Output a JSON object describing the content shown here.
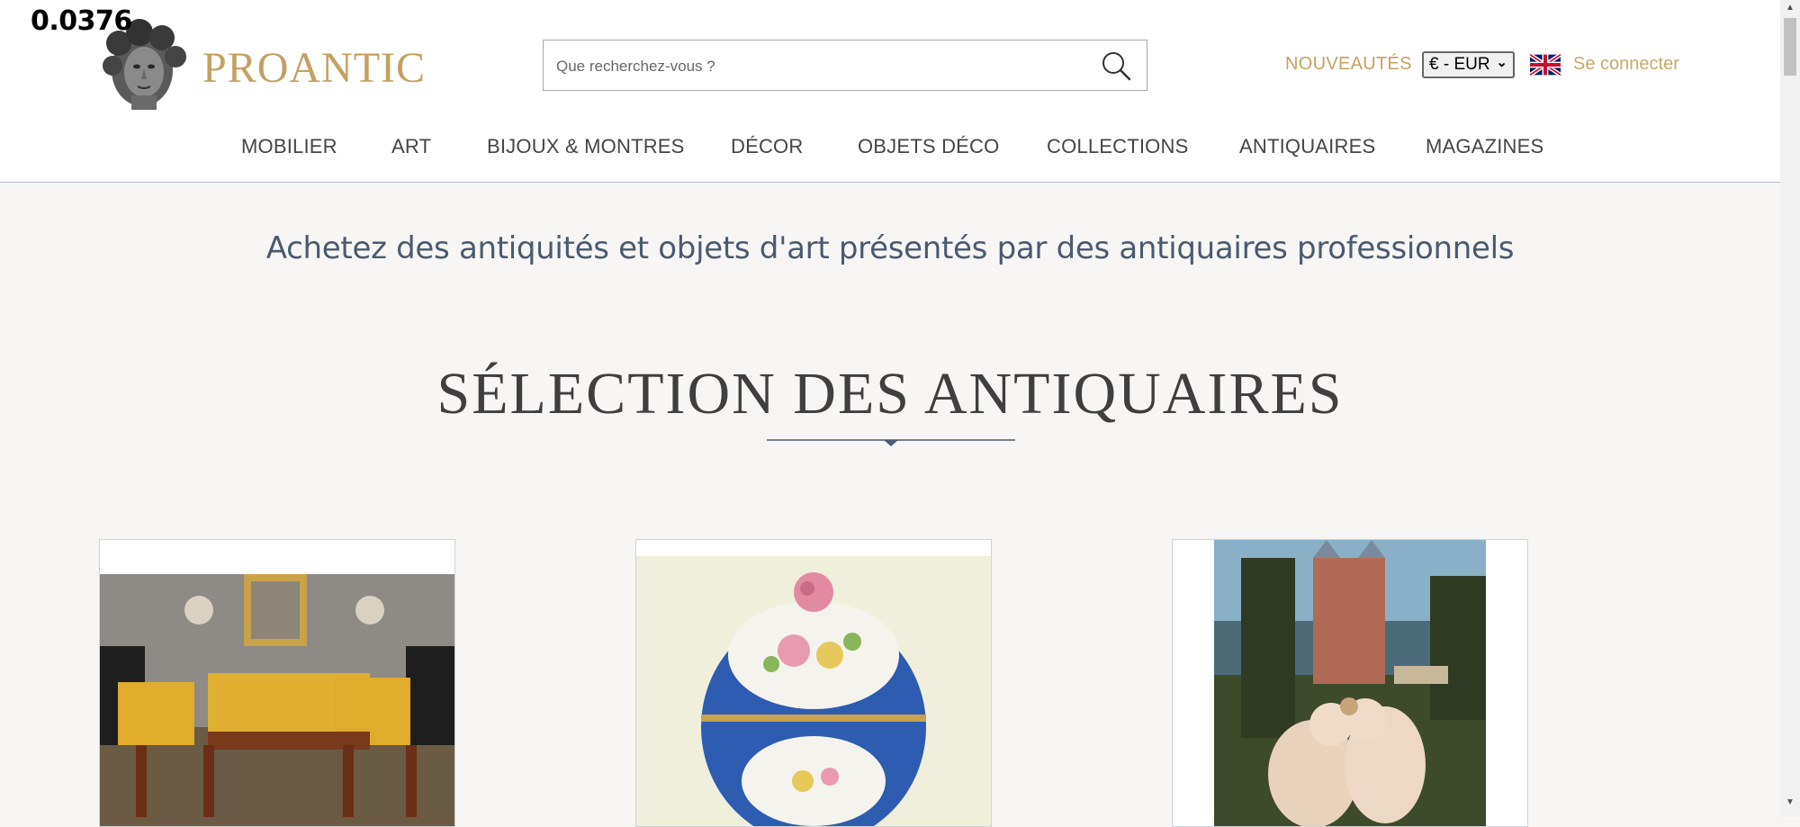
{
  "overlay": {
    "counter": "0.0376"
  },
  "brand": {
    "name": "PROANTIC",
    "gold": "#c4a062"
  },
  "search": {
    "placeholder": "Que recherchez-vous ?",
    "icon": "search-icon"
  },
  "header": {
    "nouveautes": "NOUVEAUTÉS",
    "currency": "€ - EUR",
    "language_flag": "uk-flag-icon",
    "login": "Se connecter"
  },
  "nav": {
    "items": [
      {
        "label": "MOBILIER"
      },
      {
        "label": "ART"
      },
      {
        "label": "BIJOUX & MONTRES"
      },
      {
        "label": "DÉCOR"
      },
      {
        "label": "OBJETS DÉCO"
      },
      {
        "label": "COLLECTIONS"
      },
      {
        "label": "ANTIQUAIRES"
      },
      {
        "label": "MAGAZINES"
      }
    ]
  },
  "main": {
    "tagline": "Achetez des antiquités et objets d'art présentés par des antiquaires professionnels",
    "section_title": "SÉLECTION DES ANTIQUAIRES",
    "accent": "#4a5b70"
  },
  "cards": [
    {
      "image": "salon-furniture-image"
    },
    {
      "image": "porcelain-pot-image"
    },
    {
      "image": "renaissance-painting-image"
    }
  ]
}
